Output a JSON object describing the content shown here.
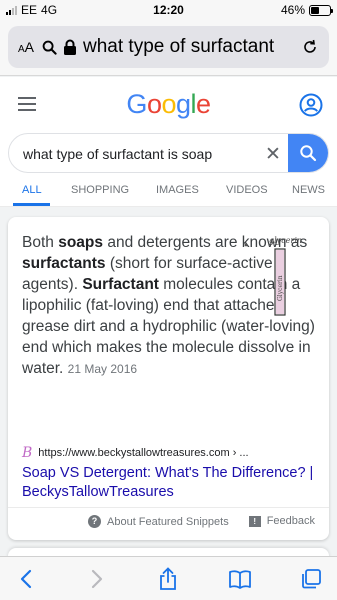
{
  "status_bar": {
    "carrier": "EE",
    "network": "4G",
    "time": "12:20",
    "battery_percent": "46%",
    "battery_level": 0.46
  },
  "safari": {
    "text_size_label_small": "A",
    "text_size_label_large": "A",
    "url_text": "what type of surfactant",
    "icons": [
      "search-icon",
      "lock-icon",
      "reload-icon"
    ]
  },
  "google": {
    "logo_letters": [
      {
        "char": "G",
        "color": "#4285f4"
      },
      {
        "char": "o",
        "color": "#ea4335"
      },
      {
        "char": "o",
        "color": "#fbbc05"
      },
      {
        "char": "g",
        "color": "#4285f4"
      },
      {
        "char": "l",
        "color": "#34a853"
      },
      {
        "char": "e",
        "color": "#ea4335"
      }
    ],
    "accent": "#4285f4"
  },
  "search": {
    "query": "what type of surfactant is soap",
    "clear_symbol": "✕"
  },
  "tabs": [
    {
      "label": "ALL",
      "active": true
    },
    {
      "label": "SHOPPING",
      "active": false
    },
    {
      "label": "IMAGES",
      "active": false
    },
    {
      "label": "VIDEOS",
      "active": false
    },
    {
      "label": "NEWS",
      "active": false
    }
  ],
  "snippet": {
    "t1": "Both ",
    "b1": "soaps",
    "t2": " and detergents are known as ",
    "b2": "surfactants",
    "t3": " (short for surface-active agents). ",
    "b3": "Surfactant",
    "t4": " molecules contain a lipophilic (fat-loving) end that attaches grease dirt and a hydrophilic (water-loving) end which makes the molecule dissolve in water.",
    "date": "21 May 2016",
    "diagram_label_top": "glycerin",
    "diagram_label_side": "Glycerin",
    "source_url": "https://www.beckystallowtreasures.com › ...",
    "favicon_letter": "B",
    "link_title": "Soap VS Detergent: What's The Difference? | BeckysTallowTreasures",
    "about_label": "About Featured Snippets",
    "about_icon_glyph": "?",
    "feedback_label": "Feedback",
    "feedback_icon_glyph": "!"
  },
  "toolbar": {
    "icons": [
      "back-icon",
      "forward-icon",
      "share-icon",
      "bookmarks-icon",
      "tabs-icon"
    ]
  }
}
